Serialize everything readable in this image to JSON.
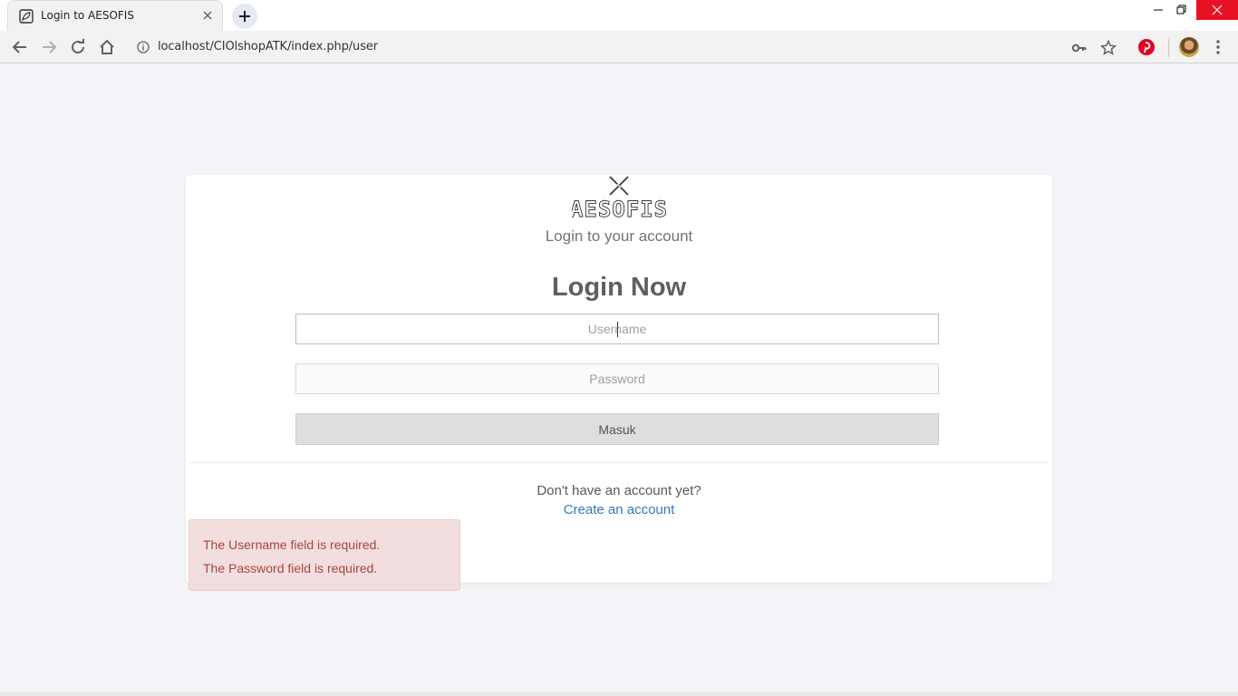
{
  "browser": {
    "tab_title": "Login to AESOFIS",
    "url": "localhost/CIOlshopATK/index.php/user",
    "colors": {
      "close_button": "#e81123",
      "tab_bg": "#f2f2f2"
    }
  },
  "login": {
    "logo_text": "AESOFIS",
    "subtitle": "Login to your account",
    "heading": "Login Now",
    "username_placeholder": "Username",
    "password_placeholder": "Password",
    "submit_label": "Masuk",
    "no_account_text": "Don't have an account yet?",
    "create_account_link": "Create an account"
  },
  "alert": {
    "messages": [
      "The Username field is required.",
      "The Password field is required."
    ],
    "colors": {
      "bg": "#f2dede",
      "text": "#a94442"
    }
  }
}
